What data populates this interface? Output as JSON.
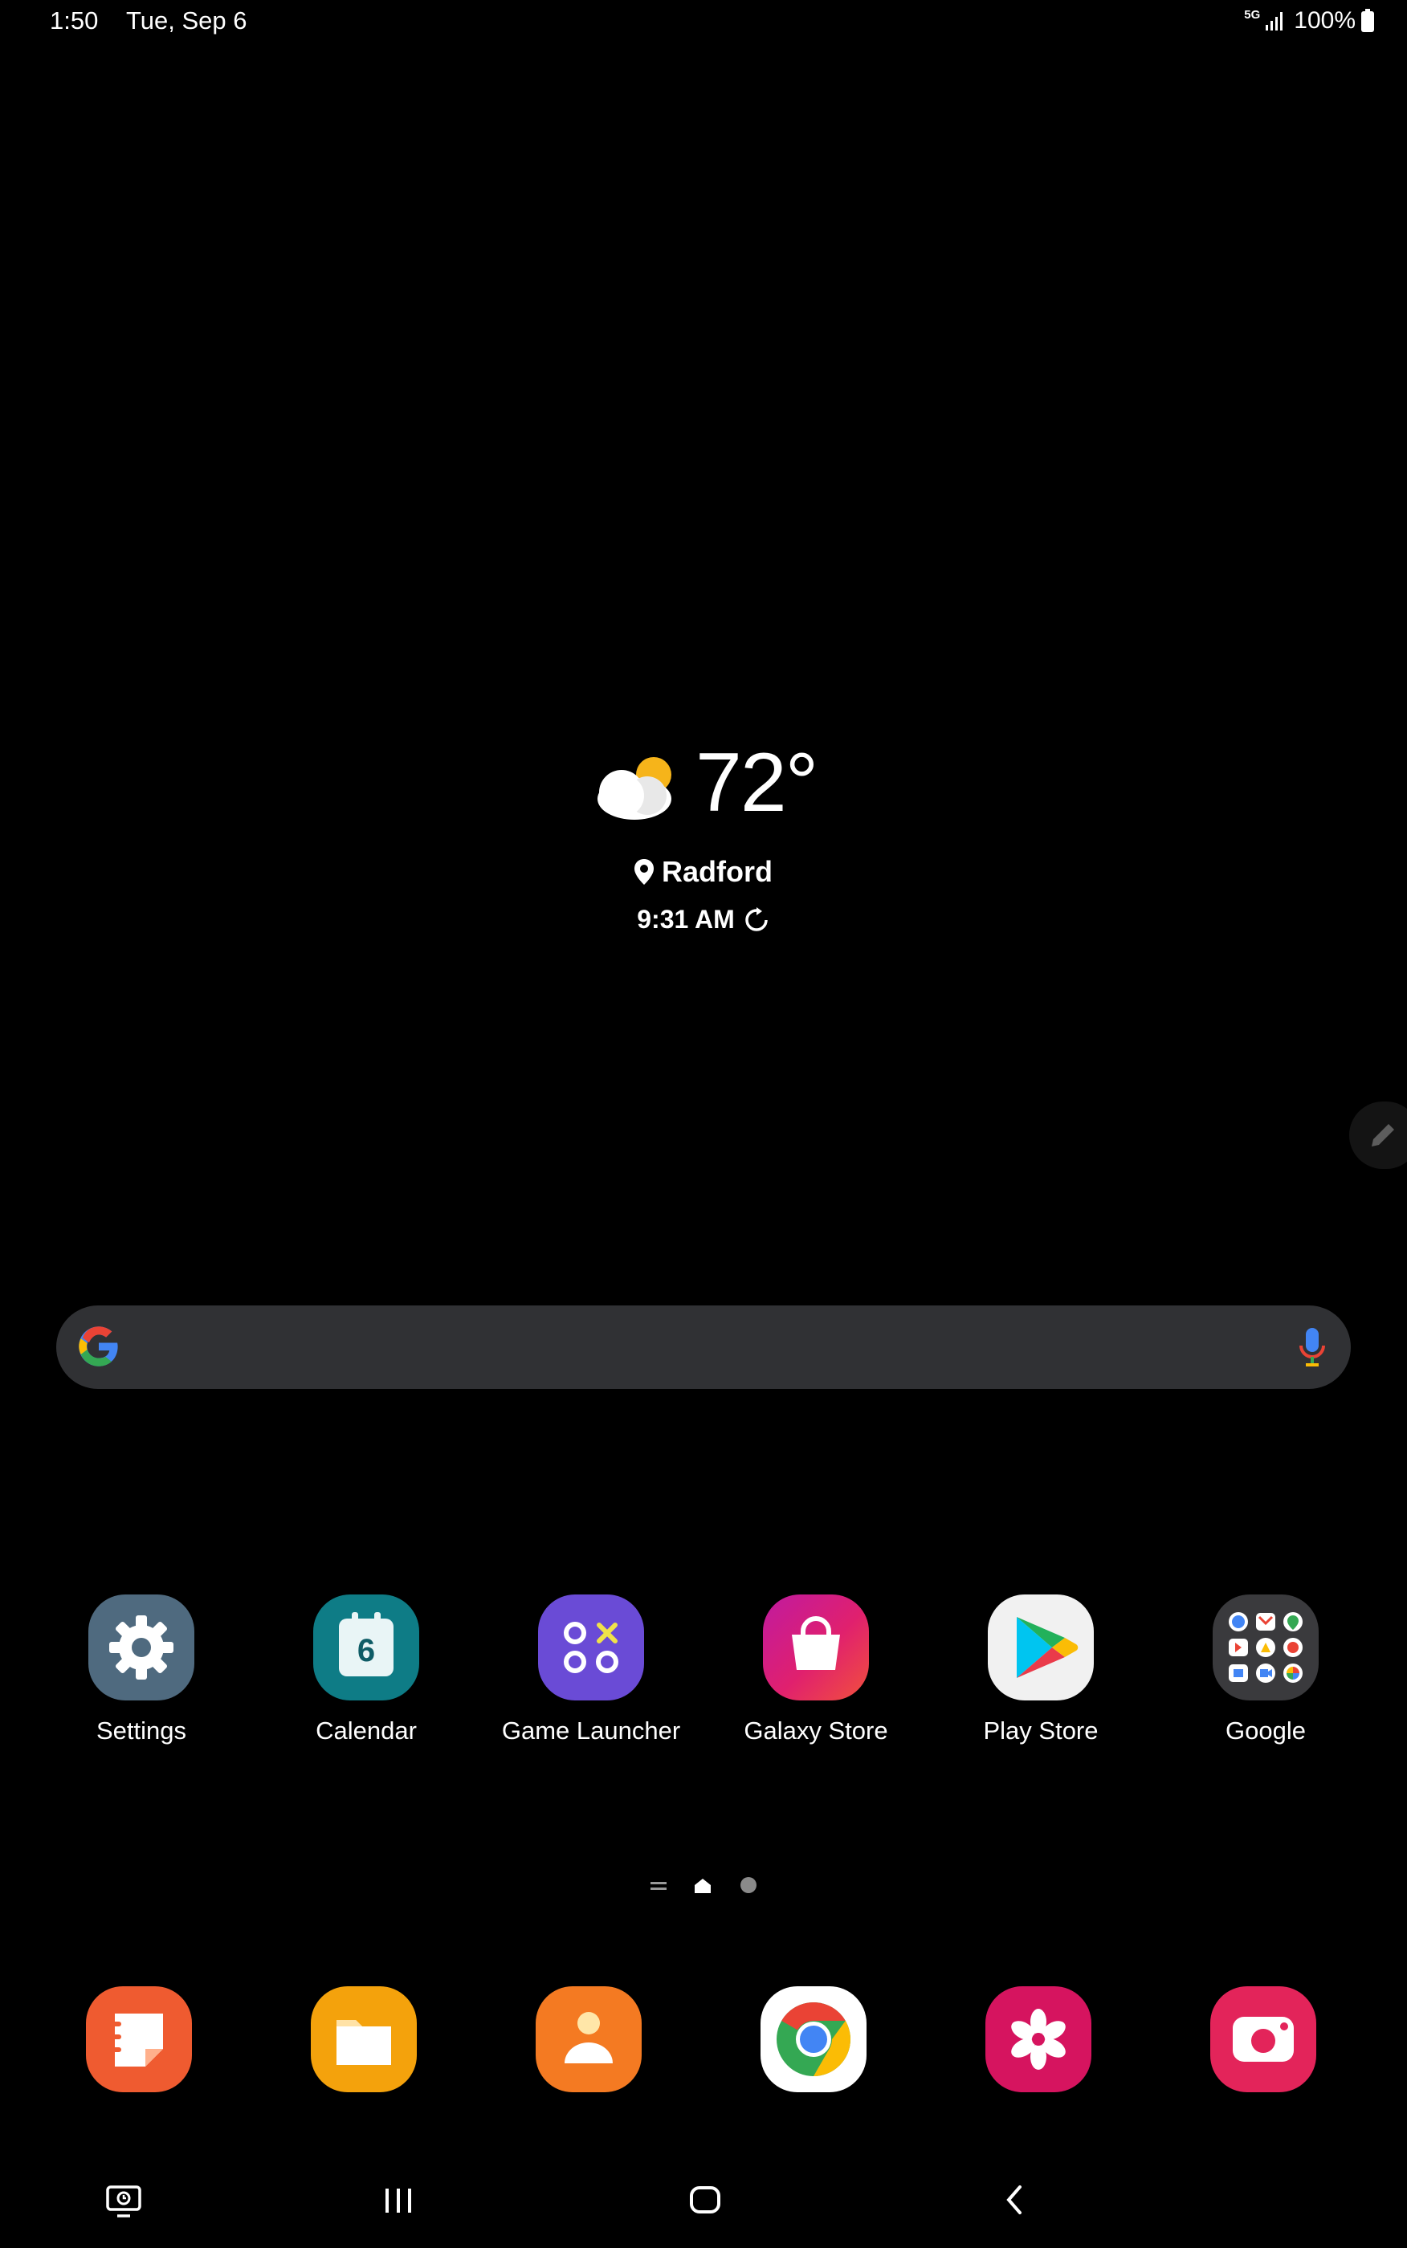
{
  "status_bar": {
    "time": "1:50",
    "date": "Tue, Sep 6",
    "network": "5G",
    "battery": "100%"
  },
  "weather": {
    "temperature": "72°",
    "location": "Radford",
    "updated": "9:31 AM",
    "condition_icon": "partly-cloudy-icon"
  },
  "search": {
    "logo": "google-g-icon",
    "mic": "mic-icon"
  },
  "apps": [
    {
      "label": "Settings",
      "icon": "settings-icon"
    },
    {
      "label": "Calendar",
      "icon": "calendar-icon",
      "badge": "6"
    },
    {
      "label": "Game Launcher",
      "icon": "game-launcher-icon"
    },
    {
      "label": "Galaxy Store",
      "icon": "galaxy-store-icon"
    },
    {
      "label": "Play Store",
      "icon": "play-store-icon"
    },
    {
      "label": "Google",
      "icon": "google-folder-icon"
    }
  ],
  "dock": [
    {
      "icon": "notes-icon"
    },
    {
      "icon": "my-files-icon"
    },
    {
      "icon": "contacts-icon"
    },
    {
      "icon": "chrome-icon"
    },
    {
      "icon": "gallery-icon"
    },
    {
      "icon": "camera-icon"
    }
  ],
  "colors": {
    "background": "#000000",
    "search_bg": "#303134",
    "settings": "#4f6a7f",
    "calendar": "#0e7c86",
    "game_launcher": "#6a4bd6",
    "play_store": "#f1f1f1",
    "google_folder": "#3a3a3d"
  }
}
